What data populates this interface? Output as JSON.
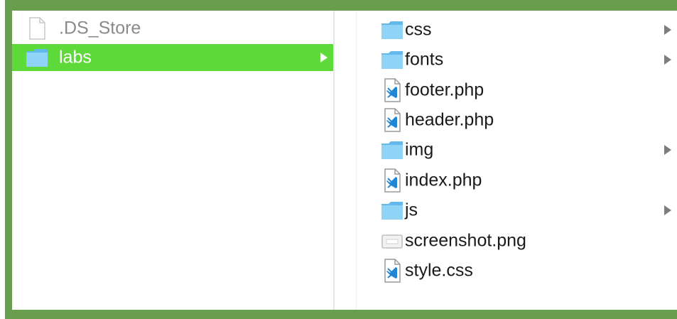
{
  "parent_column": {
    "items": [
      {
        "label": ".DS_Store",
        "icon": "blank-document-icon",
        "selected": false
      },
      {
        "label": "labs",
        "icon": "folder-icon",
        "selected": true
      }
    ]
  },
  "child_column": {
    "items": [
      {
        "label": "css",
        "icon": "folder-icon"
      },
      {
        "label": "fonts",
        "icon": "folder-icon"
      },
      {
        "label": "footer.php",
        "icon": "vscode-file-icon"
      },
      {
        "label": "header.php",
        "icon": "vscode-file-icon"
      },
      {
        "label": "img",
        "icon": "folder-icon"
      },
      {
        "label": "index.php",
        "icon": "vscode-file-icon"
      },
      {
        "label": "js",
        "icon": "folder-icon"
      },
      {
        "label": "screenshot.png",
        "icon": "image-file-icon"
      },
      {
        "label": "style.css",
        "icon": "vscode-file-icon"
      }
    ]
  },
  "colors": {
    "selection": "#5ed93a",
    "frame": "#6a9e4f",
    "folder": "#7ec8f0"
  }
}
